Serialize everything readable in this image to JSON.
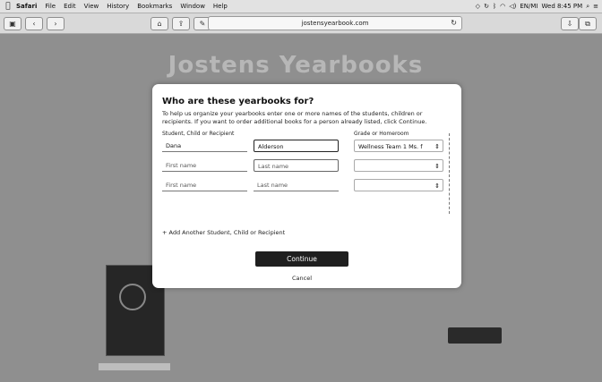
{
  "menubar": {
    "apple": "",
    "items": [
      "Safari",
      "File",
      "Edit",
      "View",
      "History",
      "Bookmarks",
      "Window",
      "Help"
    ],
    "status": {
      "input": "EN/MI",
      "datetime": "Wed 8:45 PM"
    }
  },
  "toolbar": {
    "url": "jostensyearbook.com"
  },
  "page": {
    "hero_title": "Jostens Yearbooks"
  },
  "modal": {
    "title": "Who are these yearbooks for?",
    "description": "To help us organize your yearbooks enter one or more names of the students, children or recipients. If you want to order additional books for a person already listed, click Continue.",
    "student_label": "Student, Child or Recipient",
    "grade_label": "Grade or Homeroom",
    "rows": [
      {
        "first": "Dana",
        "last": "Alderson",
        "grade": "Wellness Team 1 Ms. f"
      },
      {
        "first": "First name",
        "last": "Last name",
        "grade": ""
      },
      {
        "first": "First name",
        "last": "Last name",
        "grade": ""
      }
    ],
    "add_link": "+ Add Another Student, Child or Recipient",
    "continue_label": "Continue",
    "cancel_label": "Cancel"
  }
}
